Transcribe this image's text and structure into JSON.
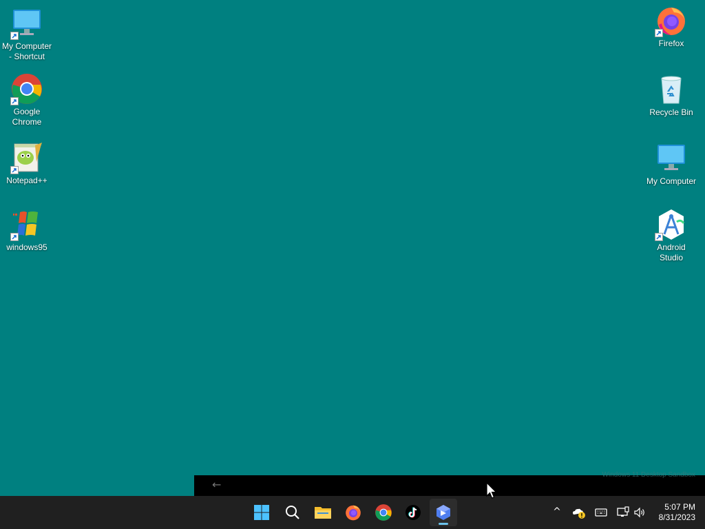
{
  "desktop": {
    "left_icons": [
      {
        "label": "My Computer - Shortcut",
        "icon": "monitor-icon",
        "shortcut": true
      },
      {
        "label": "Google Chrome",
        "icon": "chrome-icon",
        "shortcut": true
      },
      {
        "label": "Notepad++",
        "icon": "notepadpp-icon",
        "shortcut": true
      },
      {
        "label": "windows95",
        "icon": "windows95-icon",
        "shortcut": true
      }
    ],
    "right_icons": [
      {
        "label": "Firefox",
        "icon": "firefox-icon",
        "shortcut": true
      },
      {
        "label": "Recycle Bin",
        "icon": "recycle-bin-icon",
        "shortcut": false
      },
      {
        "label": "My Computer",
        "icon": "monitor-icon",
        "shortcut": false
      },
      {
        "label": "Android Studio",
        "icon": "android-studio-icon",
        "shortcut": true
      }
    ]
  },
  "strip": {
    "back_glyph": "←",
    "watermark": "Windows 11 Desktop Sandbox"
  },
  "taskbar": {
    "apps": [
      {
        "name": "start",
        "icon": "windows-start-icon"
      },
      {
        "name": "search",
        "icon": "search-icon"
      },
      {
        "name": "file-explorer",
        "icon": "folder-icon"
      },
      {
        "name": "firefox",
        "icon": "firefox-icon"
      },
      {
        "name": "chrome",
        "icon": "chrome-icon"
      },
      {
        "name": "tiktok",
        "icon": "tiktok-icon"
      },
      {
        "name": "active-app",
        "icon": "app-icon",
        "active": true
      }
    ],
    "tray": {
      "overflow": "^",
      "time": "5:07 PM",
      "date": "8/31/2023"
    }
  },
  "colors": {
    "desktop_bg": "#008080",
    "taskbar_bg": "#202020",
    "accent": "#6cc2ea"
  }
}
